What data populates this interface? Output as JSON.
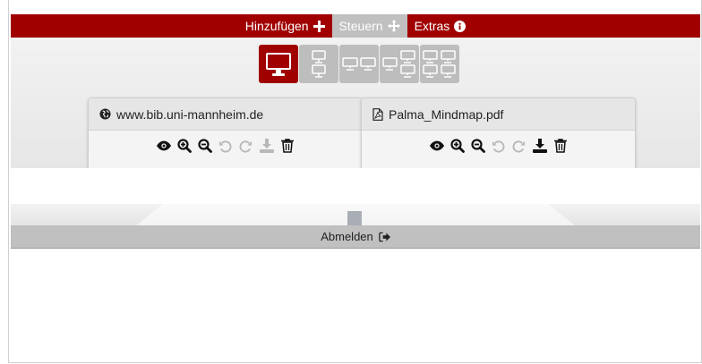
{
  "nav": {
    "items": [
      {
        "label": "Hinzufügen",
        "icon": "plus-icon"
      },
      {
        "label": "Steuern",
        "icon": "move-icon"
      },
      {
        "label": "Extras",
        "icon": "info-icon"
      }
    ]
  },
  "layouts": [
    {
      "name": "single-screen",
      "active": true
    },
    {
      "name": "two-vertical",
      "active": false
    },
    {
      "name": "two-horizontal",
      "active": false
    },
    {
      "name": "three-screens",
      "active": false
    },
    {
      "name": "four-screens",
      "active": false
    }
  ],
  "panels": [
    {
      "title": "www.bib.uni-mannheim.de",
      "icon": "globe-icon"
    },
    {
      "title": "Palma_Mindmap.pdf",
      "icon": "pdf-file-icon"
    }
  ],
  "footer": {
    "logout_label": "Abmelden",
    "icon": "sign-out-icon"
  },
  "colors": {
    "brand": "#a00000",
    "inactive": "#c0c0c0",
    "disabled_icon": "#b8b8b8"
  }
}
